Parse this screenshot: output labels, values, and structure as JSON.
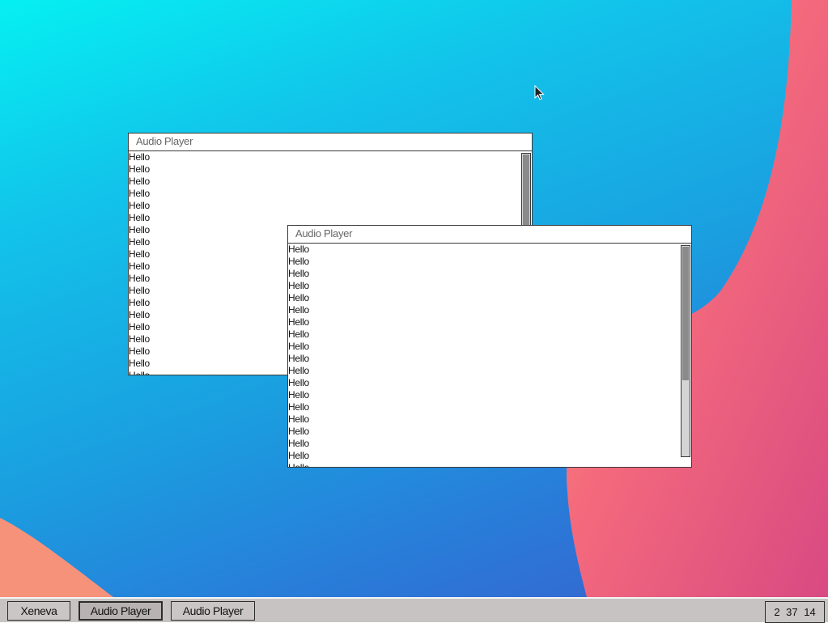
{
  "windows": [
    {
      "title": "Audio Player",
      "items": [
        "Hello",
        "Hello",
        "Hello",
        "Hello",
        "Hello",
        "Hello",
        "Hello",
        "Hello",
        "Hello",
        "Hello",
        "Hello",
        "Hello",
        "Hello",
        "Hello",
        "Hello",
        "Hello",
        "Hello",
        "Hello",
        "Hello"
      ]
    },
    {
      "title": "Audio Player",
      "items": [
        "Hello",
        "Hello",
        "Hello",
        "Hello",
        "Hello",
        "Hello",
        "Hello",
        "Hello",
        "Hello",
        "Hello",
        "Hello",
        "Hello",
        "Hello",
        "Hello",
        "Hello",
        "Hello",
        "Hello",
        "Hello",
        "Hello"
      ]
    }
  ],
  "taskbar": {
    "items": [
      {
        "label": "Xeneva",
        "active": false
      },
      {
        "label": "Audio Player",
        "active": true
      },
      {
        "label": "Audio Player",
        "active": false
      }
    ],
    "clock": "2 37 14"
  },
  "colors": {
    "wallpaper_top": "#05f0f2",
    "wallpaper_bottom": "#3a5fcc",
    "wave_pink": "#f2637a",
    "wave_orange": "#f9a07a",
    "taskbar": "#c8c3c3"
  },
  "icons": {
    "cursor": "mouse-pointer-icon"
  }
}
